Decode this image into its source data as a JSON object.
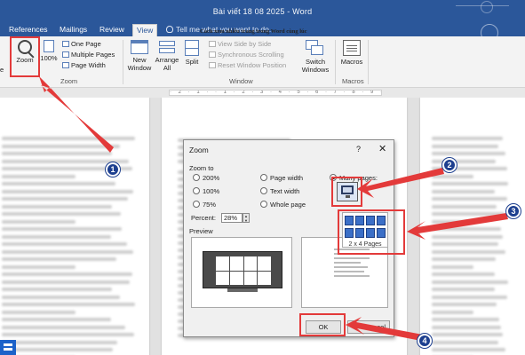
{
  "window": {
    "title": "Bài viết 18 08 2025 - Word"
  },
  "tabs": [
    {
      "label": "References"
    },
    {
      "label": "Mailings"
    },
    {
      "label": "Review"
    },
    {
      "label": "View",
      "active": true
    }
  ],
  "tell_me": "Tell me what you want to do...",
  "ribbon": {
    "edge_label": "e",
    "zoom_group": {
      "label": "Zoom",
      "zoom_button": "Zoom",
      "hundred_button": "100%",
      "one_page": "One Page",
      "multiple_pages": "Multiple Pages",
      "page_width": "Page Width"
    },
    "window_group": {
      "label": "Window",
      "new_window": [
        "New",
        "Window"
      ],
      "arrange_all": [
        "Arrange",
        "All"
      ],
      "split": "Split",
      "view_side_by_side": "View Side by Side",
      "sync_scrolling": "Synchronous Scrolling",
      "reset_window_position": "Reset Window Position",
      "switch_windows": [
        "Switch",
        "Windows"
      ]
    },
    "macros_group": {
      "label": "Macros",
      "macros_button": "Macros"
    }
  },
  "ruler_text": "· 2 · 1 ·  · 1 · 2 · 3 · 4 · 5 · 6 · 7 · 8 · 9 · 10 ·",
  "document": {
    "heading": "Cách xem nhiều trang trong Word cùng lúc"
  },
  "zoom_dialog": {
    "title": "Zoom",
    "help": "?",
    "close": "✕",
    "zoom_to_label": "Zoom to",
    "options": {
      "p200": "200%",
      "p100": "100%",
      "p75": "75%",
      "page_width": "Page width",
      "text_width": "Text width",
      "whole_page": "Whole page",
      "many_pages": "Many pages:"
    },
    "selected_option": "many_pages",
    "percent_label": "Percent:",
    "percent_value": "28%",
    "preview_label": "Preview",
    "page_grid_label": "2 x 4 Pages",
    "ok_button": "OK",
    "cancel_button": "Cancel",
    "cancel_visible_fragment": "cel"
  },
  "callouts": [
    "1",
    "2",
    "3",
    "4"
  ],
  "colors": {
    "word_blue": "#2b579a",
    "highlight_red": "#e33a3a",
    "callout_navy": "#1d3f8f",
    "page_tile_blue": "#3b6fc7"
  },
  "icons": {
    "zoom": "magnifier-icon",
    "one_page": "page-icon",
    "new_window": "window-icon",
    "macros": "macro-icon"
  }
}
